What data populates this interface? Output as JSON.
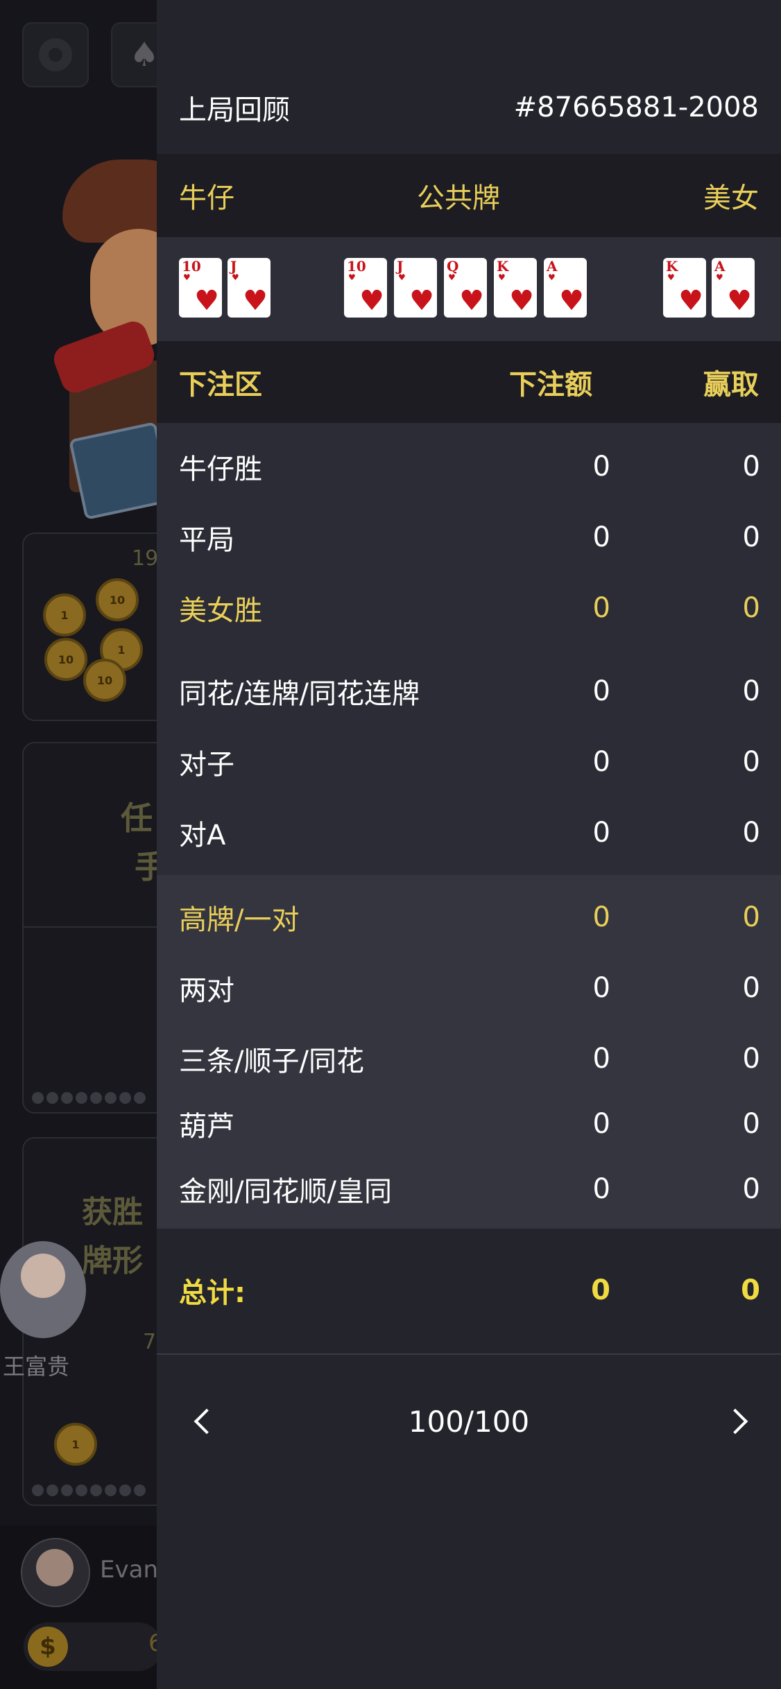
{
  "background": {
    "player_name": "王富贵",
    "me_name": "Evan",
    "money": "6",
    "panel1_count": "19",
    "panel3_count": "7",
    "panel_win_type_line1": "获胜",
    "panel_win_type_line2": "牌形",
    "panel2_line1": "任",
    "panel2_line2": "手"
  },
  "review": {
    "title": "上局回顾",
    "round_id": "#87665881-2008",
    "side_left": "牛仔",
    "side_center": "公共牌",
    "side_right": "美女",
    "cowboy_cards": [
      {
        "rank": "10",
        "suit": "hearts"
      },
      {
        "rank": "J",
        "suit": "hearts"
      }
    ],
    "community_cards": [
      {
        "rank": "10",
        "suit": "hearts"
      },
      {
        "rank": "J",
        "suit": "hearts"
      },
      {
        "rank": "Q",
        "suit": "hearts"
      },
      {
        "rank": "K",
        "suit": "hearts"
      },
      {
        "rank": "A",
        "suit": "hearts"
      }
    ],
    "beauty_cards": [
      {
        "rank": "K",
        "suit": "hearts"
      },
      {
        "rank": "A",
        "suit": "hearts"
      }
    ],
    "table_header": {
      "area": "下注区",
      "bet": "下注额",
      "win": "赢取"
    },
    "rows": [
      {
        "label": "牛仔胜",
        "bet": "0",
        "win": "0"
      },
      {
        "label": "平局",
        "bet": "0",
        "win": "0"
      },
      {
        "label": "美女胜",
        "bet": "0",
        "win": "0"
      },
      {
        "label": "同花/连牌/同花连牌",
        "bet": "0",
        "win": "0"
      },
      {
        "label": "对子",
        "bet": "0",
        "win": "0"
      },
      {
        "label": "对A",
        "bet": "0",
        "win": "0"
      },
      {
        "label": "高牌/一对",
        "bet": "0",
        "win": "0"
      },
      {
        "label": "两对",
        "bet": "0",
        "win": "0"
      },
      {
        "label": "三条/顺子/同花",
        "bet": "0",
        "win": "0"
      },
      {
        "label": "葫芦",
        "bet": "0",
        "win": "0"
      },
      {
        "label": "金刚/同花顺/皇同",
        "bet": "0",
        "win": "0"
      }
    ],
    "total": {
      "label": "总计:",
      "bet": "0",
      "win": "0"
    },
    "page": "100/100"
  },
  "colors": {
    "accent_gold": "#e9cf5a",
    "panel_bg": "#23242c",
    "heart_red": "#c8131b"
  }
}
